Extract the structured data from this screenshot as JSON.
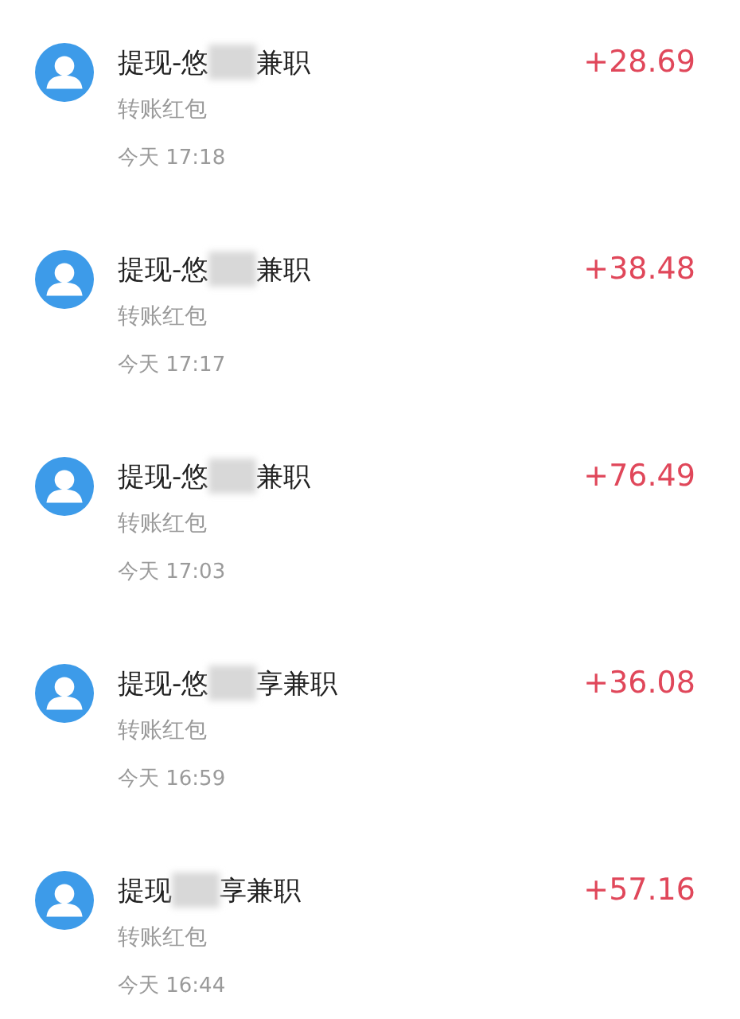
{
  "transactions": [
    {
      "title_parts": [
        "提现-悠",
        "兼职"
      ],
      "subtitle": "转账红包",
      "time": "今天 17:18",
      "amount": "+28.69"
    },
    {
      "title_parts": [
        "提现-悠",
        "兼职"
      ],
      "subtitle": "转账红包",
      "time": "今天 17:17",
      "amount": "+38.48"
    },
    {
      "title_parts": [
        "提现-悠",
        "兼职"
      ],
      "subtitle": "转账红包",
      "time": "今天 17:03",
      "amount": "+76.49"
    },
    {
      "title_parts": [
        "提现-悠",
        "享兼职"
      ],
      "subtitle": "转账红包",
      "time": "今天 16:59",
      "amount": "+36.08"
    },
    {
      "title_parts": [
        "提现",
        "享兼职"
      ],
      "subtitle": "转账红包",
      "time": "今天 16:44",
      "amount": "+57.16"
    }
  ]
}
